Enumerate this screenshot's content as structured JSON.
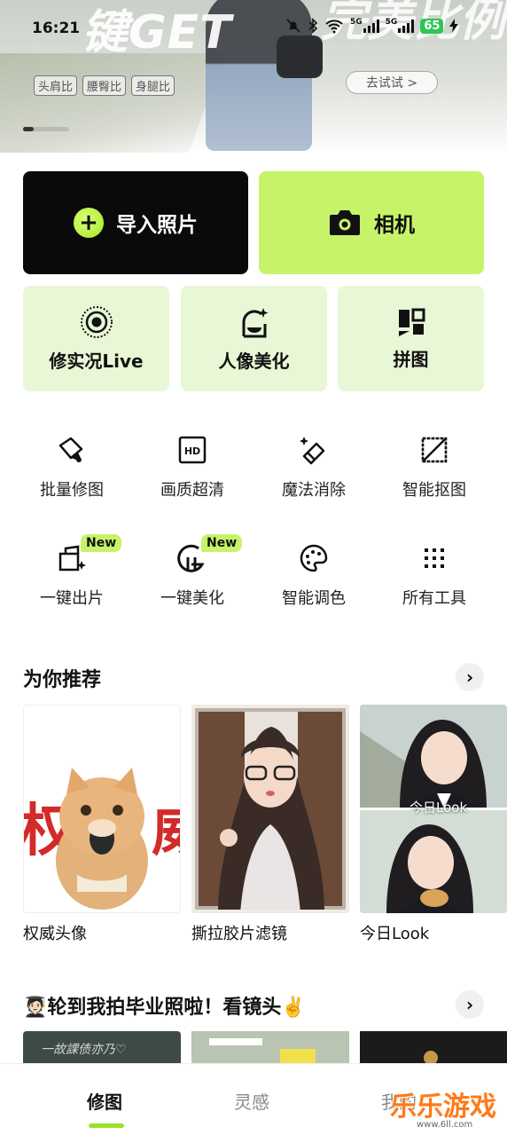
{
  "status_bar": {
    "time": "16:21",
    "battery": "65",
    "net1": "5G",
    "net2": "5G"
  },
  "banner": {
    "headline_left": "键GET",
    "headline_right": "完美比例",
    "tags": [
      "头肩比",
      "腰臀比",
      "身腿比"
    ],
    "try_label": "去试试 >"
  },
  "primary_actions": {
    "import_label": "导入照片",
    "camera_label": "相机"
  },
  "features": [
    {
      "label": "修实况Live",
      "icon": "live-photo-icon"
    },
    {
      "label": "人像美化",
      "icon": "portrait-beauty-icon"
    },
    {
      "label": "拼图",
      "icon": "collage-icon"
    }
  ],
  "tools": [
    {
      "label": "批量修图",
      "icon": "batch-edit-icon",
      "badge": ""
    },
    {
      "label": "画质超清",
      "icon": "hd-icon",
      "badge": ""
    },
    {
      "label": "魔法消除",
      "icon": "magic-eraser-icon",
      "badge": ""
    },
    {
      "label": "智能抠图",
      "icon": "cutout-icon",
      "badge": ""
    },
    {
      "label": "一键出片",
      "icon": "one-tap-output-icon",
      "badge": "New"
    },
    {
      "label": "一键美化",
      "icon": "one-tap-beauty-icon",
      "badge": "New"
    },
    {
      "label": "智能调色",
      "icon": "palette-icon",
      "badge": ""
    },
    {
      "label": "所有工具",
      "icon": "grid-dots-icon",
      "badge": ""
    }
  ],
  "recommend": {
    "title": "为你推荐",
    "items": [
      {
        "label": "权威头像",
        "overlay": ""
      },
      {
        "label": "撕拉胶片滤镜",
        "overlay": ""
      },
      {
        "label": "今日Look",
        "overlay": "今日Look"
      }
    ],
    "cat_text_left": "权",
    "cat_text_right": "威"
  },
  "graduation": {
    "title": "🧑🏻‍🎓轮到我拍毕业照啦！看镜头✌️",
    "board_text": "一故課债亦乃♡"
  },
  "tabs": [
    {
      "label": "修图",
      "active": true
    },
    {
      "label": "灵感",
      "active": false
    },
    {
      "label": "我的",
      "active": false
    }
  ],
  "watermark": {
    "text": "乐乐游戏",
    "url": "www.6ll.com"
  },
  "colors": {
    "accent": "#c6f36a",
    "feature_bg": "#e8f7d5",
    "dark_card": "#0a0a0a"
  }
}
